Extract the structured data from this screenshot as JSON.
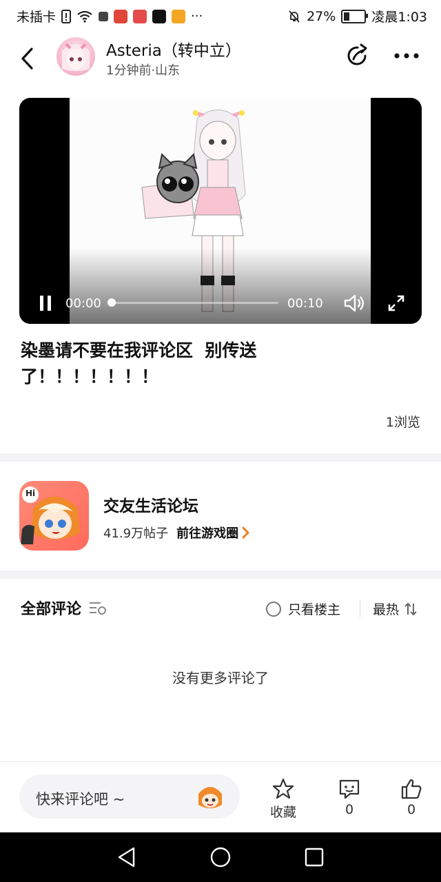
{
  "status_bar": {
    "carrier": "未插卡",
    "battery": "27%",
    "battery_level": 0.27,
    "time": "凌晨1:03"
  },
  "header": {
    "username": "Asteria（转中立）",
    "time_location": "1分钟前·山东"
  },
  "video": {
    "current_time": "00:00",
    "total_time": "00:10",
    "progress": 0
  },
  "post": {
    "title_line1": "染墨请不要在我评论区  别传送",
    "title_line2": "了！！！！！！！",
    "views": "1浏览"
  },
  "forum": {
    "name": "交友生活论坛",
    "posts": "41.9万帖子",
    "go_label": "前往游戏圈",
    "icon_text": "Hi"
  },
  "comments": {
    "heading": "全部评论",
    "only_host_label": "只看楼主",
    "sort_label": "最热",
    "empty_text": "没有更多评论了"
  },
  "bottom_bar": {
    "input_placeholder": "快来评论吧 ~",
    "favorite_label": "收藏",
    "comment_count": "0",
    "like_count": "0"
  },
  "colors": {
    "accent_orange": "#f07c1e",
    "forum_bg": "#ff7a6a",
    "video_bg": "#000000"
  }
}
